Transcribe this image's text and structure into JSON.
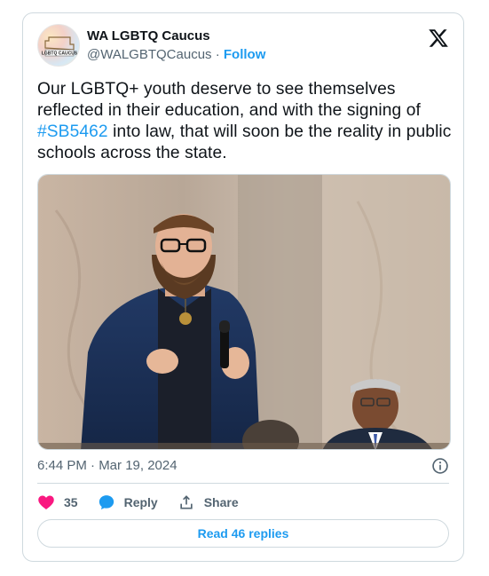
{
  "author": {
    "display_name": "WA LGBTQ Caucus",
    "handle": "@WALGBTQCaucus",
    "separator": " · ",
    "follow_label": "Follow",
    "avatar_text": "LGBTQ CAUCUS"
  },
  "tweet": {
    "text_before": "Our LGBTQ+ youth deserve to see themselves reflected in their education, and with the signing of ",
    "hashtag": "#SB5462",
    "text_after": " into law, that will soon be the reality in public schools across the state.",
    "timestamp": "6:44 PM · Mar 19, 2024"
  },
  "actions": {
    "like_count": "35",
    "reply_label": "Reply",
    "share_label": "Share",
    "read_replies_label": "Read 46 replies"
  },
  "icons": {
    "brand": "x-logo-icon",
    "info": "info-icon",
    "like": "heart-icon",
    "reply": "speech-bubble-icon",
    "share": "share-upload-icon"
  },
  "colors": {
    "accent": "#1d9bf0",
    "like": "#f91880",
    "secondary_text": "#536471",
    "border": "#cfd9de"
  }
}
